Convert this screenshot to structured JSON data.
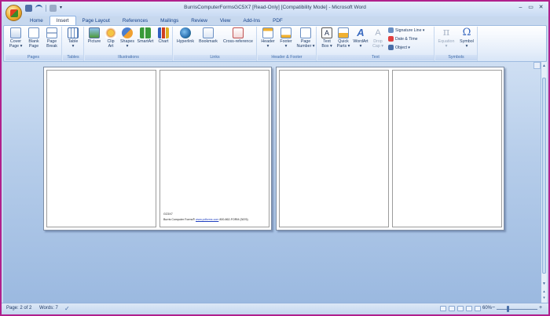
{
  "window": {
    "title": "BurrisComputerFormsGC5X7 [Read-Only] [Compatibility Mode] - Microsoft Word"
  },
  "tabs": [
    "Home",
    "Insert",
    "Page Layout",
    "References",
    "Mailings",
    "Review",
    "View",
    "Add-Ins",
    "PDF"
  ],
  "active_tab": "Insert",
  "ribbon": {
    "pages": {
      "label": "Pages",
      "cover": "Cover\nPage ▾",
      "blank": "Blank\nPage",
      "break": "Page\nBreak"
    },
    "tables": {
      "label": "Tables",
      "table": "Table\n▾"
    },
    "illustrations": {
      "label": "Illustrations",
      "picture": "Picture",
      "clipart": "Clip\nArt",
      "shapes": "Shapes\n▾",
      "smartart": "SmartArt",
      "chart": "Chart"
    },
    "links": {
      "label": "Links",
      "hyperlink": "Hyperlink",
      "bookmark": "Bookmark",
      "crossref": "Cross-reference"
    },
    "header_footer": {
      "label": "Header & Footer",
      "header": "Header\n▾",
      "footer": "Footer\n▾",
      "page_number": "Page\nNumber ▾"
    },
    "text": {
      "label": "Text",
      "textbox": "Text\nBox ▾",
      "quickparts": "Quick\nParts ▾",
      "wordart": "WordArt\n▾",
      "dropcap": "Drop\nCap ▾",
      "signature": "Signature Line ▾",
      "datetime": "Date & Time",
      "object": "Object ▾"
    },
    "symbols": {
      "label": "Symbols",
      "equation": "Equation\n▾",
      "symbol": "Symbol\n▾"
    }
  },
  "document": {
    "footer_line1": "GC5X7",
    "footer_prefix": "Burris Computer Forms® ",
    "footer_link": "www.pdforms.com",
    "footer_suffix": " 800-862-FORM (3676)"
  },
  "status": {
    "page": "Page: 2 of 2",
    "words": "Words: 7",
    "zoom": "60%"
  },
  "colors": {
    "frame_border": "#b0208c",
    "ribbon_bg": "#dbe7f7",
    "doc_bg": "#b6cdea"
  }
}
